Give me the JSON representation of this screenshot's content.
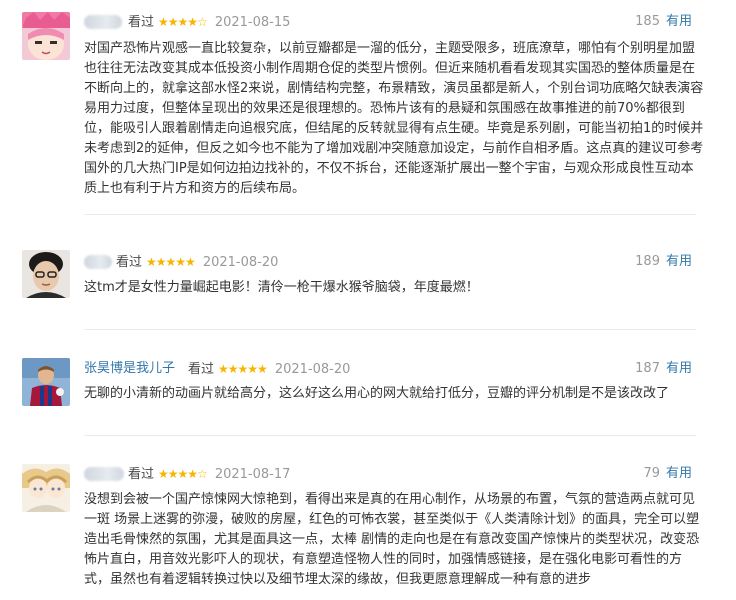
{
  "reviews": [
    {
      "username": "",
      "watched_label": "看过",
      "stars": "★★★★☆",
      "date": "2021-08-15",
      "votes": "185",
      "useful_label": "有用",
      "content": "对国产恐怖片观感一直比较复杂，以前豆瓣都是一溜的低分，主题受限多，班底潦草，哪怕有个别明星加盟也往往无法改变其成本低投资小制作周期仓促的类型片惯例。但近来随机看看发现其实国恐的整体质量是在不断向上的，就拿这部水怪2来说，剧情结构完整，布景精致，演员虽都是新人，个别台词功底略欠缺表演容易用力过度，但整体呈现出的效果还是很理想的。恐怖片该有的悬疑和氛围感在故事推进的前70%都很到位，能吸引人跟着剧情走向追根究底，但结尾的反转就显得有点生硬。毕竟是系列剧，可能当初拍1的时候并未考虑到2的延伸，但反之如今也不能为了增加戏剧冲突随意加设定，与前作自相矛盾。这点真的建议可参考国外的几大热门IP是如何边拍边找补的，不仅不拆台，还能逐渐扩展出一整个宇宙，与观众形成良性互动本质上也有利于片方和资方的后续布局。"
    },
    {
      "username": "",
      "watched_label": "看过",
      "stars": "★★★★★",
      "date": "2021-08-20",
      "votes": "189",
      "useful_label": "有用",
      "content": "这tm才是女性力量崛起电影！清伶一枪干爆水猴爷脑袋，年度最燃！"
    },
    {
      "username": "张昊博是我儿子",
      "watched_label": "看过",
      "stars": "★★★★★",
      "date": "2021-08-20",
      "votes": "187",
      "useful_label": "有用",
      "content": "无聊的小清新的动画片就给高分，这么好这么用心的网大就给打低分，豆瓣的评分机制是不是该改改了"
    },
    {
      "username": "",
      "watched_label": "看过",
      "stars": "★★★★☆",
      "date": "2021-08-17",
      "votes": "79",
      "useful_label": "有用",
      "content": "没想到会被一个国产惊悚网大惊艳到，看得出来是真的在用心制作，从场景的布置，气氛的营造两点就可见一斑 场景上迷雾的弥漫，破败的房屋，红色的可怖衣裳，甚至类似于《人类清除计划》的面具，完全可以塑造出毛骨悚然的氛围，尤其是面具这一点，太棒 剧情的走向也是在有意改变国产惊悚片的类型状况，改变恐怖片直白，用音效光影吓人的现状，有意塑造怪物人性的同时，加强情感链接，是在强化电影可看性的方式，虽然也有着逻辑转换过快以及细节埋太深的缘故，但我更愿意理解成一种有意的进步"
    }
  ]
}
